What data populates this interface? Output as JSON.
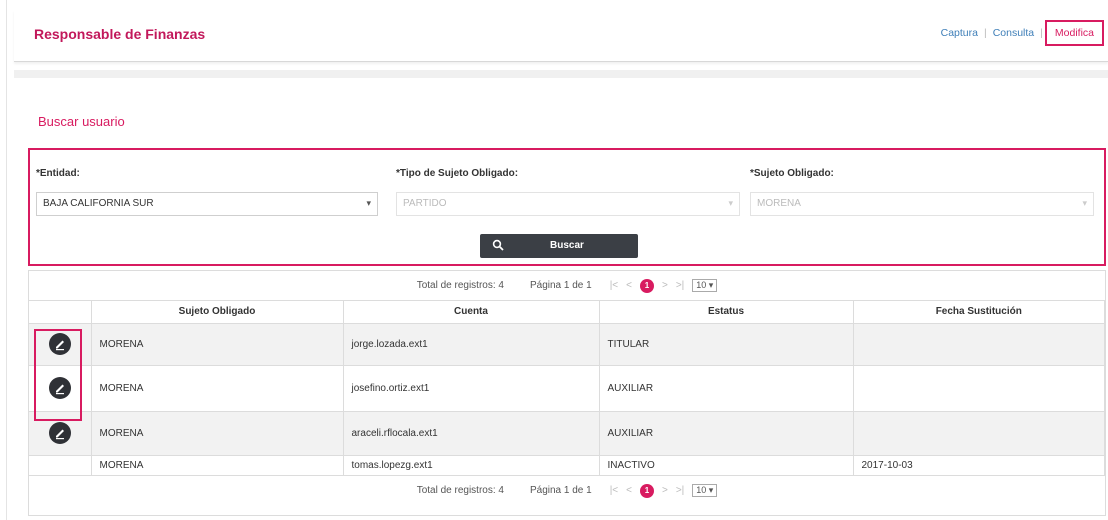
{
  "header": {
    "title": "Responsable de Finanzas",
    "nav": {
      "capture": "Captura",
      "consult": "Consulta",
      "modify": "Modifica",
      "separator": "|"
    }
  },
  "search": {
    "title": "Buscar usuario",
    "entidad_label": "*Entidad:",
    "entidad_value": "BAJA CALIFORNIA SUR",
    "tipo_label": "*Tipo de Sujeto Obligado:",
    "tipo_value": "PARTIDO",
    "sujeto_label": "*Sujeto Obligado:",
    "sujeto_value": "MORENA",
    "button_label": "Buscar"
  },
  "pager": {
    "total": "Total de registros: 4",
    "page": "Página 1 de 1",
    "current": "1",
    "page_size": "10 ▾"
  },
  "table": {
    "headers": [
      "Sujeto Obligado",
      "Cuenta",
      "Estatus",
      "Fecha Sustitución"
    ],
    "rows": [
      {
        "sujeto": "MORENA",
        "cuenta": "jorge.lozada.ext1",
        "estatus": "TITULAR",
        "fecha": ""
      },
      {
        "sujeto": "MORENA",
        "cuenta": "josefino.ortiz.ext1",
        "estatus": "AUXILIAR",
        "fecha": ""
      },
      {
        "sujeto": "MORENA",
        "cuenta": "araceli.rflocala.ext1",
        "estatus": "AUXILIAR",
        "fecha": ""
      },
      {
        "sujeto": "MORENA",
        "cuenta": "tomas.lopezg.ext1",
        "estatus": "INACTIVO",
        "fecha": "2017-10-03"
      }
    ]
  },
  "colors": {
    "accent": "#d81b60",
    "link": "#3f7fb8",
    "button": "#3b3f45"
  }
}
